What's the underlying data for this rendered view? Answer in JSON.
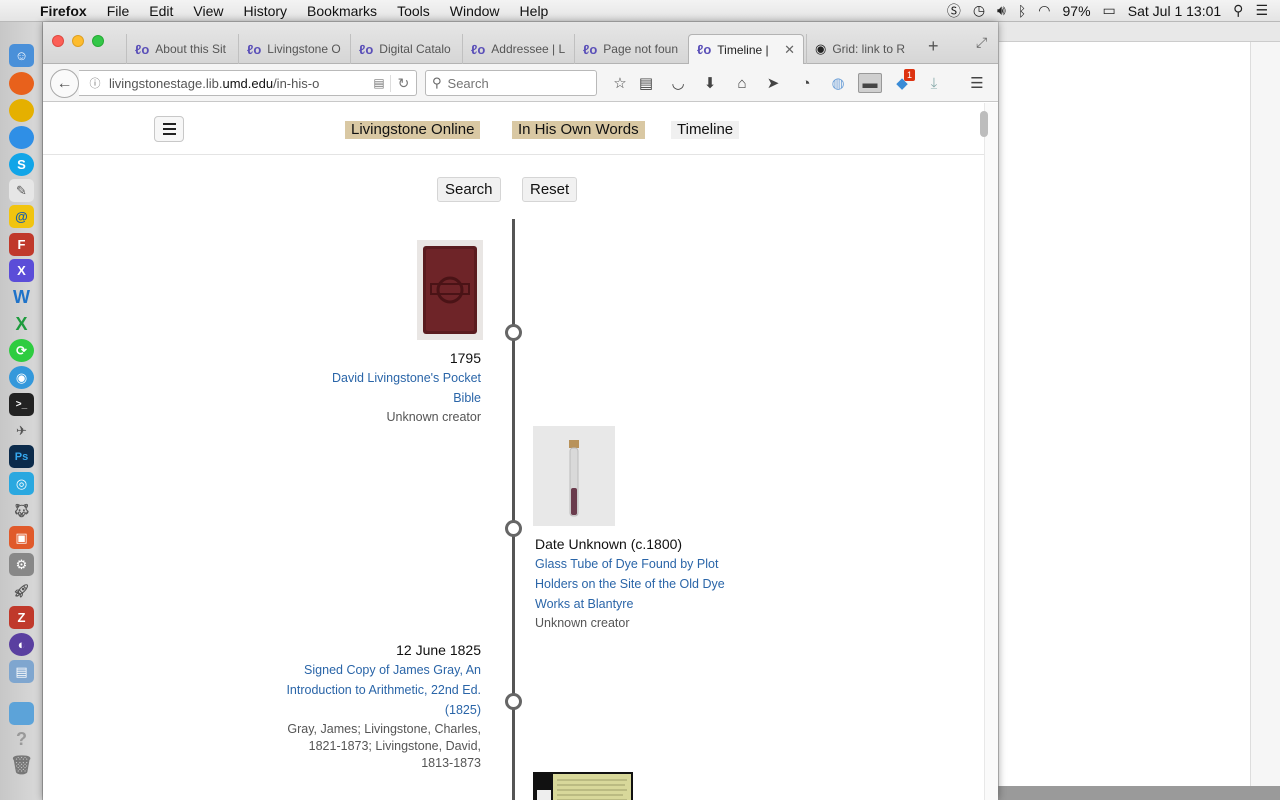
{
  "menubar": {
    "app": "Firefox",
    "menus": [
      "File",
      "Edit",
      "View",
      "History",
      "Bookmarks",
      "Tools",
      "Window",
      "Help"
    ],
    "battery": "97%",
    "clock": "Sat Jul 1  13:01"
  },
  "browser": {
    "tabs": [
      {
        "label": "About this Sit",
        "icon": "lo-favicon"
      },
      {
        "label": "Livingstone O",
        "icon": "lo-favicon"
      },
      {
        "label": "Digital Catalo",
        "icon": "lo-favicon"
      },
      {
        "label": "Addressee | L",
        "icon": "lo-favicon"
      },
      {
        "label": "Page not foun",
        "icon": "lo-favicon"
      },
      {
        "label": "Timeline |",
        "icon": "lo-favicon",
        "active": true
      },
      {
        "label": "Grid: link to R",
        "icon": "github-favicon"
      }
    ],
    "url_prefix": "livingstonestage.lib.",
    "url_domain": "umd.edu",
    "url_suffix": "/in-his-o",
    "search_placeholder": "Search",
    "notification_count": "1"
  },
  "site": {
    "nav": {
      "livingstone_online": "Livingstone Online",
      "in_his_own_words": "In His Own Words",
      "timeline": "Timeline"
    },
    "search_button": "Search",
    "reset_button": "Reset"
  },
  "timeline": {
    "entries": [
      {
        "date": "1795",
        "title_lines": [
          "David Livingstone's Pocket",
          "Bible"
        ],
        "creator_lines": [
          "Unknown creator"
        ]
      },
      {
        "date": "Date Unknown (c.1800)",
        "title_lines": [
          "Glass Tube of Dye Found by Plot",
          "Holders on the Site of the Old Dye",
          "Works at Blantyre"
        ],
        "creator_lines": [
          "Unknown creator"
        ]
      },
      {
        "date": "12 June 1825",
        "title_lines": [
          "Signed Copy of James Gray, An",
          "Introduction to Arithmetic, 22nd Ed.",
          "(1825)"
        ],
        "creator_lines": [
          "Gray, James; Livingstone, Charles,",
          "1821-1873; Livingstone, David,",
          "1813-1873"
        ]
      }
    ]
  },
  "colors": {
    "nav_tan": "#d9c8a3",
    "link_blue": "#2a65a8",
    "axis": "#555555"
  }
}
